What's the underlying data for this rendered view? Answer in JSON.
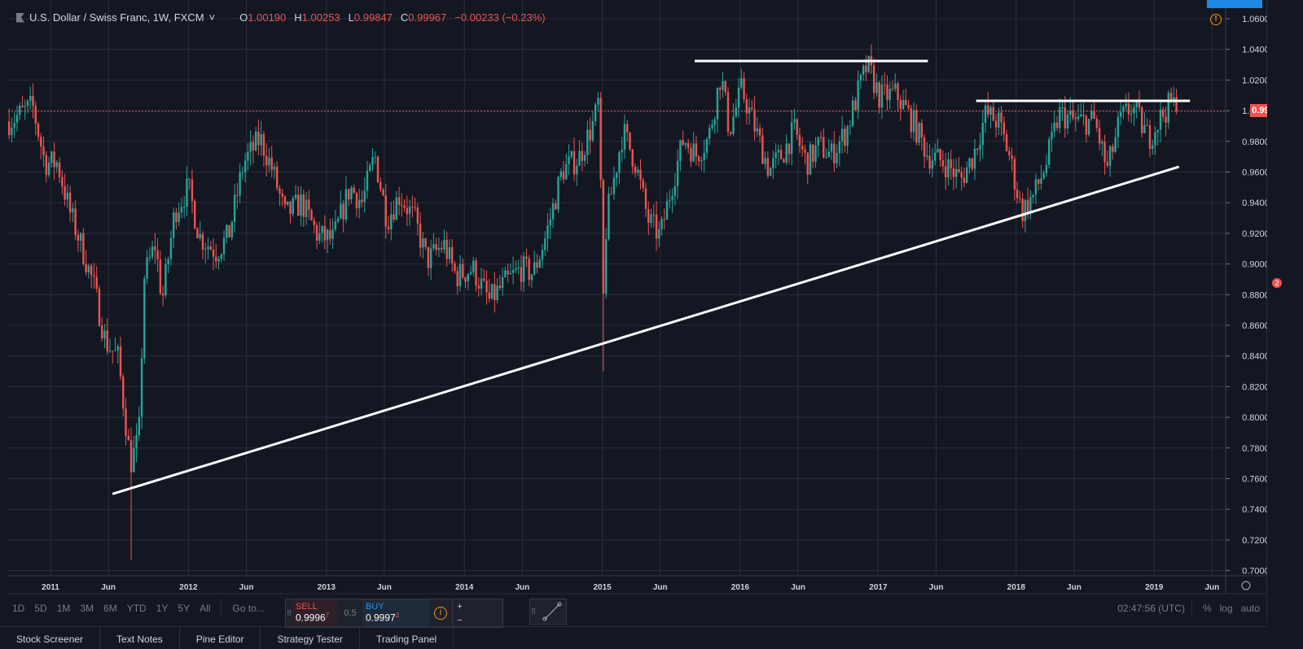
{
  "header": {
    "symbol": "U.S. Dollar / Swiss Franc, 1W, FXCM",
    "open_label": "O",
    "open": "1.00190",
    "high_label": "H",
    "high": "1.00253",
    "low_label": "L",
    "low": "0.99847",
    "close_label": "C",
    "close": "0.99967",
    "change": "−0.00233 (−0.23%)"
  },
  "current_price": "0.99967",
  "ranges": [
    "1D",
    "5D",
    "1M",
    "3M",
    "6M",
    "YTD",
    "1Y",
    "5Y",
    "All"
  ],
  "goto": "Go to...",
  "trade": {
    "sell_label": "SELL",
    "sell_price": "0.9996",
    "sell_pip": "7",
    "spread": "0.5",
    "buy_label": "BUY",
    "buy_price": "0.9997",
    "buy_pip": "2",
    "plus": "+",
    "minus": "−"
  },
  "clock": "02:47:56 (UTC)",
  "scale": {
    "percent": "%",
    "log": "log",
    "auto": "auto"
  },
  "tabs": [
    "Stock Screener",
    "Text Notes",
    "Pine Editor",
    "Strategy Tester",
    "Trading Panel"
  ],
  "badge": "2",
  "colors": {
    "up": "#26a69a",
    "down": "#ef5350",
    "bg": "#131722",
    "grid": "#2a2e39",
    "line": "#ffffff"
  },
  "chart_data": {
    "type": "candlestick",
    "title": "U.S. Dollar / Swiss Franc, 1W, FXCM",
    "ylim": [
      0.69,
      1.07
    ],
    "xlim": [
      2010.68,
      2019.55
    ],
    "yticks": [
      "1.06000",
      "1.04000",
      "1.02000",
      "1.00000",
      "0.98000",
      "0.96000",
      "0.94000",
      "0.92000",
      "0.90000",
      "0.88000",
      "0.86000",
      "0.84000",
      "0.82000",
      "0.80000",
      "0.78000",
      "0.76000",
      "0.74000",
      "0.72000",
      "0.70000"
    ],
    "ytick_values": [
      1.06,
      1.04,
      1.02,
      1.0,
      0.98,
      0.96,
      0.94,
      0.92,
      0.9,
      0.88,
      0.86,
      0.84,
      0.82,
      0.8,
      0.78,
      0.76,
      0.74,
      0.72,
      0.7
    ],
    "xticks": [
      {
        "t": 2011,
        "label": "2011"
      },
      {
        "t": 2011.42,
        "label": "Jun"
      },
      {
        "t": 2012,
        "label": "2012"
      },
      {
        "t": 2012.42,
        "label": "Jun"
      },
      {
        "t": 2013,
        "label": "2013"
      },
      {
        "t": 2013.42,
        "label": "Jun"
      },
      {
        "t": 2014,
        "label": "2014"
      },
      {
        "t": 2014.42,
        "label": "Jun"
      },
      {
        "t": 2015,
        "label": "2015"
      },
      {
        "t": 2015.42,
        "label": "Jun"
      },
      {
        "t": 2016,
        "label": "2016"
      },
      {
        "t": 2016.42,
        "label": "Jun"
      },
      {
        "t": 2017,
        "label": "2017"
      },
      {
        "t": 2017.42,
        "label": "Jun"
      },
      {
        "t": 2018,
        "label": "2018"
      },
      {
        "t": 2018.42,
        "label": "Jun"
      },
      {
        "t": 2019,
        "label": "2019"
      },
      {
        "t": 2019.42,
        "label": "Jun"
      }
    ],
    "close_waypoints": [
      [
        2010.7,
        0.993
      ],
      [
        2010.87,
        1.003
      ],
      [
        2010.96,
        0.966
      ],
      [
        2011.05,
        0.966
      ],
      [
        2011.14,
        0.934
      ],
      [
        2011.22,
        0.913
      ],
      [
        2011.31,
        0.887
      ],
      [
        2011.4,
        0.849
      ],
      [
        2011.49,
        0.839
      ],
      [
        2011.58,
        0.77
      ],
      [
        2011.64,
        0.786
      ],
      [
        2011.68,
        0.892
      ],
      [
        2011.76,
        0.913
      ],
      [
        2011.81,
        0.876
      ],
      [
        2011.9,
        0.934
      ],
      [
        2012.0,
        0.95
      ],
      [
        2012.08,
        0.918
      ],
      [
        2012.2,
        0.908
      ],
      [
        2012.29,
        0.918
      ],
      [
        2012.4,
        0.966
      ],
      [
        2012.52,
        0.982
      ],
      [
        2012.61,
        0.961
      ],
      [
        2012.7,
        0.932
      ],
      [
        2012.82,
        0.94
      ],
      [
        2012.94,
        0.918
      ],
      [
        2013.05,
        0.916
      ],
      [
        2013.17,
        0.95
      ],
      [
        2013.26,
        0.94
      ],
      [
        2013.35,
        0.971
      ],
      [
        2013.44,
        0.929
      ],
      [
        2013.53,
        0.945
      ],
      [
        2013.64,
        0.929
      ],
      [
        2013.73,
        0.902
      ],
      [
        2013.85,
        0.913
      ],
      [
        2013.94,
        0.892
      ],
      [
        2014.06,
        0.897
      ],
      [
        2014.18,
        0.876
      ],
      [
        2014.29,
        0.887
      ],
      [
        2014.41,
        0.897
      ],
      [
        2014.5,
        0.894
      ],
      [
        2014.59,
        0.918
      ],
      [
        2014.71,
        0.961
      ],
      [
        2014.83,
        0.969
      ],
      [
        2014.94,
        0.993
      ],
      [
        2014.98,
        1.009
      ],
      [
        2015.0,
        0.86
      ],
      [
        2015.03,
        0.929
      ],
      [
        2015.15,
        0.987
      ],
      [
        2015.24,
        0.966
      ],
      [
        2015.33,
        0.929
      ],
      [
        2015.42,
        0.918
      ],
      [
        2015.5,
        0.95
      ],
      [
        2015.59,
        0.982
      ],
      [
        2015.68,
        0.971
      ],
      [
        2015.77,
        0.982
      ],
      [
        2015.86,
        1.024
      ],
      [
        2015.92,
        0.987
      ],
      [
        2016.01,
        1.014
      ],
      [
        2016.09,
        0.993
      ],
      [
        2016.21,
        0.961
      ],
      [
        2016.3,
        0.971
      ],
      [
        2016.39,
        0.987
      ],
      [
        2016.48,
        0.966
      ],
      [
        2016.57,
        0.977
      ],
      [
        2016.66,
        0.971
      ],
      [
        2016.77,
        0.987
      ],
      [
        2016.86,
        1.014
      ],
      [
        2016.92,
        1.03
      ],
      [
        2017.01,
        1.009
      ],
      [
        2017.13,
        1.011
      ],
      [
        2017.25,
        0.993
      ],
      [
        2017.36,
        0.971
      ],
      [
        2017.48,
        0.966
      ],
      [
        2017.6,
        0.955
      ],
      [
        2017.69,
        0.971
      ],
      [
        2017.78,
        0.998
      ],
      [
        2017.87,
        0.993
      ],
      [
        2017.95,
        0.971
      ],
      [
        2018.04,
        0.934
      ],
      [
        2018.13,
        0.945
      ],
      [
        2018.22,
        0.966
      ],
      [
        2018.31,
        0.998
      ],
      [
        2018.43,
        0.993
      ],
      [
        2018.57,
        0.993
      ],
      [
        2018.66,
        0.961
      ],
      [
        2018.75,
        0.993
      ],
      [
        2018.84,
        1.003
      ],
      [
        2018.96,
        0.982
      ],
      [
        2019.05,
        0.996
      ],
      [
        2019.13,
        1.006
      ],
      [
        2019.16,
        0.9997
      ]
    ],
    "extreme_lows": [
      [
        2011.58,
        0.707
      ],
      [
        2015.0,
        0.83
      ]
    ],
    "trendlines": [
      {
        "name": "rising-support",
        "from": [
          2011.45,
          0.75
        ],
        "to": [
          2019.18,
          0.9634
        ]
      },
      {
        "name": "resistance-2016",
        "from": [
          2015.67,
          1.0324
        ],
        "to": [
          2017.36,
          1.0324
        ]
      },
      {
        "name": "resistance-2018",
        "from": [
          2017.71,
          1.0064
        ],
        "to": [
          2019.26,
          1.0064
        ]
      }
    ],
    "last_price": 0.99967
  }
}
